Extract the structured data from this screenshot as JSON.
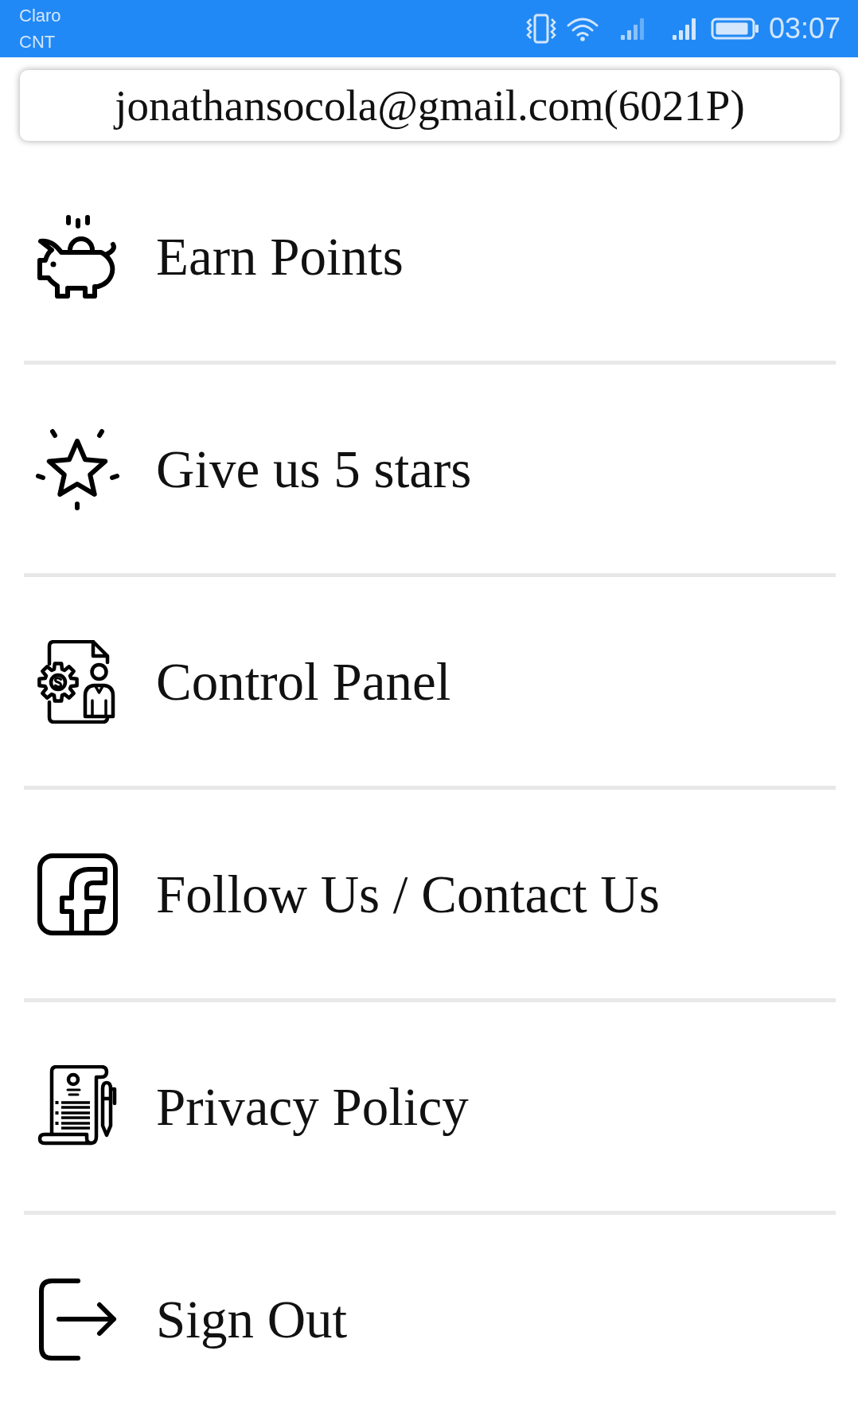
{
  "status_bar": {
    "carrier": [
      "Claro",
      "CNT"
    ],
    "time": "03:07"
  },
  "account": {
    "email": "jonathansocola@gmail.com(6021P)"
  },
  "menu": {
    "items": [
      {
        "label": "Earn Points"
      },
      {
        "label": "Give us 5 stars"
      },
      {
        "label": "Control Panel"
      },
      {
        "label": "Follow Us / Contact Us"
      },
      {
        "label": "Privacy Policy"
      },
      {
        "label": "Sign Out"
      }
    ]
  }
}
